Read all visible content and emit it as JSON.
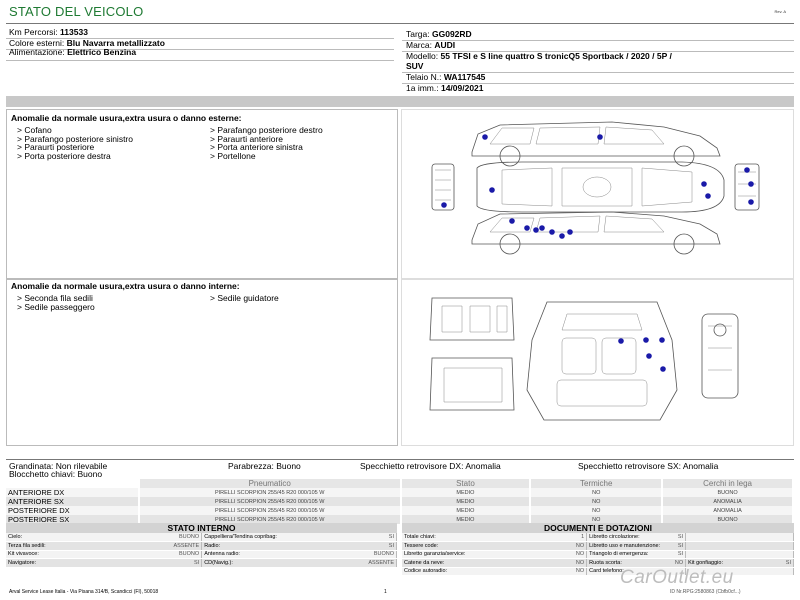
{
  "header": {
    "title": "STATO DEL VEICOLO",
    "revision": "Rev. A"
  },
  "vehicle": {
    "left": [
      {
        "label": "Km Percorsi:",
        "value": "113533"
      },
      {
        "label": "Colore esterni:",
        "value": "Blu Navarra metallizzato"
      },
      {
        "label": "Alimentazione:",
        "value": "Elettrico Benzina"
      }
    ],
    "targa": {
      "label": "Targa:",
      "value": "GG092RD"
    },
    "marca": {
      "label": "Marca:",
      "value": "AUDI"
    },
    "modello": {
      "label": "Modello:",
      "value_line1": "55 TFSI e S line quattro S tronicQ5 Sportback / 2020 / 5P /",
      "value_line2": "SUV"
    },
    "telaio": {
      "label": "Telaio N.:",
      "value": "WA117545"
    },
    "immatricolazione": {
      "label": "1a imm.:",
      "value": "14/09/2021"
    }
  },
  "external_damage": {
    "title": "Anomalie da normale usura,extra usura o danno esterne:",
    "col1": [
      "> Cofano",
      "> Parafango posteriore sinistro",
      "> Paraurti posteriore",
      "> Porta posteriore destra"
    ],
    "col2": [
      "> Parafango posteriore destro",
      "> Paraurti anteriore",
      "> Porta anteriore sinistra",
      "> Portellone"
    ]
  },
  "internal_damage": {
    "title": "Anomalie da normale usura,extra usura o danno interne:",
    "col1": [
      "> Seconda fila sedili",
      "> Sedile passeggero"
    ],
    "col2": [
      "> Sedile guidatore"
    ]
  },
  "info": {
    "grandinata": "Grandinata: Non rilevabile",
    "parabrezza": "Parabrezza: Buono",
    "specchietto_dx": "Specchietto retrovisore DX: Anomalia",
    "specchietto_sx": "Specchietto retrovisore SX: Anomalia",
    "blocchetto": "Blocchetto chiavi: Buono"
  },
  "tyres": {
    "headers": {
      "pneumatico": "Pneumatico",
      "stato": "Stato",
      "termiche": "Termiche",
      "cerchi": "Cerchi in lega"
    },
    "rows": [
      {
        "position": "ANTERIORE DX",
        "tyre": "PIRELLI  SCORPION  255/45 R20 000/105 W",
        "stato": "MEDIO",
        "termiche": "NO",
        "cerchi": "BUONO"
      },
      {
        "position": "ANTERIORE SX",
        "tyre": "PIRELLI  SCORPION  255/45 R20 000/105 W",
        "stato": "MEDIO",
        "termiche": "NO",
        "cerchi": "ANOMALIA"
      },
      {
        "position": "POSTERIORE DX",
        "tyre": "PIRELLI  SCORPION  255/45 R20 000/105 W",
        "stato": "MEDIO",
        "termiche": "NO",
        "cerchi": "ANOMALIA"
      },
      {
        "position": "POSTERIORE SX",
        "tyre": "PIRELLI  SCORPION  255/45 R20 000/105 W",
        "stato": "MEDIO",
        "termiche": "NO",
        "cerchi": "BUONO"
      }
    ]
  },
  "stato_interno": {
    "title": "STATO INTERNO",
    "rows": [
      [
        "Cielo:",
        "BUONO",
        "Cappelliera/Tendina copribag:",
        "SI"
      ],
      [
        "Terza fila sedili:",
        "ASSENTE",
        "Radio:",
        "SI"
      ],
      [
        "Kit vivavoce:",
        "BUONO",
        "Antenna radio:",
        "BUONO"
      ],
      [
        "Navigatore:",
        "SI",
        "CD(Navig.):",
        "ASSENTE"
      ]
    ]
  },
  "documenti": {
    "title": "DOCUMENTI E DOTAZIONI",
    "rows": [
      [
        "Totale chiavi:",
        "1",
        "Libretto circolazione:",
        "SI",
        "",
        ""
      ],
      [
        "Tessere code:",
        "NO",
        "Libretto uso e manutenzione:",
        "SI",
        "",
        ""
      ],
      [
        "Libretto garanzia/service:",
        "NO",
        "Triangolo di emergenza:",
        "SI",
        "",
        ""
      ],
      [
        "Catene da neve:",
        "NO",
        "Ruota scorta:",
        "NO",
        "Kit gonfiaggio:",
        "SI"
      ],
      [
        "Codice autoradio:",
        "NO",
        "Card telefono:",
        "",
        "",
        ""
      ]
    ]
  },
  "footer": {
    "company": "Arval Service Lease Italia - Via Pisana 314/B, Scandicci (FI), 50018",
    "page": "1",
    "id_text": "ID Nr.RPG:2580863 (Cbfb0cf...)",
    "watermark": "CarOutlet.eu"
  },
  "colors": {
    "title_green": "#1f7a33",
    "damage_dot": "#1a1aa8",
    "grey_bar": "#c8c8c8"
  }
}
